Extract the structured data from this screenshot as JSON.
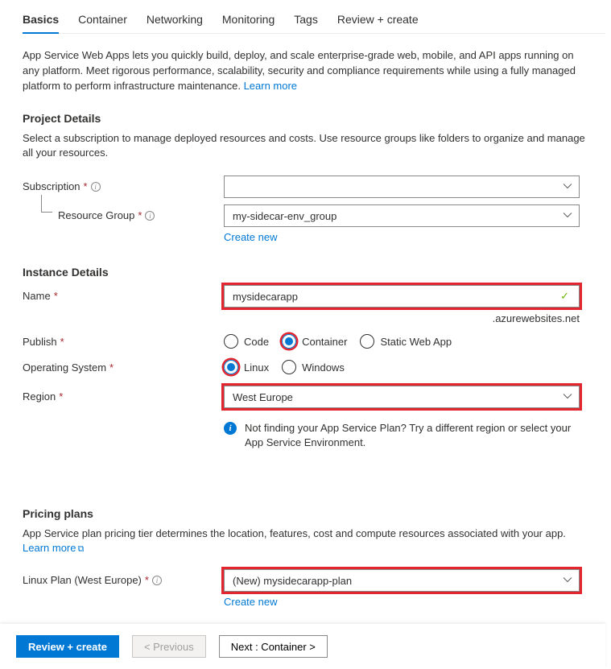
{
  "tabs": [
    "Basics",
    "Container",
    "Networking",
    "Monitoring",
    "Tags",
    "Review + create"
  ],
  "intro": {
    "text": "App Service Web Apps lets you quickly build, deploy, and scale enterprise-grade web, mobile, and API apps running on any platform. Meet rigorous performance, scalability, security and compliance requirements while using a fully managed platform to perform infrastructure maintenance.  ",
    "learn_more": "Learn more"
  },
  "project": {
    "heading": "Project Details",
    "desc": "Select a subscription to manage deployed resources and costs. Use resource groups like folders to organize and manage all your resources.",
    "subscription_label": "Subscription",
    "subscription_value": "",
    "rg_label": "Resource Group",
    "rg_value": "my-sidecar-env_group",
    "create_new": "Create new"
  },
  "instance": {
    "heading": "Instance Details",
    "name_label": "Name",
    "name_value": "mysidecarapp",
    "domain_suffix": ".azurewebsites.net",
    "publish_label": "Publish",
    "publish_options": [
      "Code",
      "Container",
      "Static Web App"
    ],
    "os_label": "Operating System",
    "os_options": [
      "Linux",
      "Windows"
    ],
    "region_label": "Region",
    "region_value": "West Europe",
    "info_text": "Not finding your App Service Plan? Try a different region or select your App Service Environment."
  },
  "pricing": {
    "heading": "Pricing plans",
    "desc": "App Service plan pricing tier determines the location, features, cost and compute resources associated with your app. ",
    "learn_more": "Learn more",
    "plan_label": "Linux Plan (West Europe)",
    "plan_value": "(New) mysidecarapp-plan",
    "create_new": "Create new"
  },
  "footer": {
    "review": "Review + create",
    "prev": "< Previous",
    "next": "Next : Container >"
  }
}
